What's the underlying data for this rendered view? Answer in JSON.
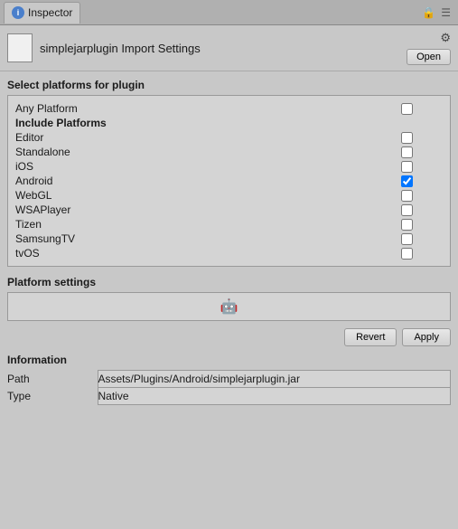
{
  "tab": {
    "label": "Inspector",
    "icon": "i"
  },
  "header": {
    "title": "simplejarplugin Import Settings",
    "open_label": "Open",
    "gear_symbol": "⚙"
  },
  "platforms_section": {
    "title": "Select platforms for plugin",
    "include_title": "Include Platforms",
    "platforms": [
      {
        "name": "Any Platform",
        "checked": false,
        "bold": false
      },
      {
        "name": "Editor",
        "checked": false,
        "bold": false
      },
      {
        "name": "Standalone",
        "checked": false,
        "bold": false
      },
      {
        "name": "iOS",
        "checked": false,
        "bold": false
      },
      {
        "name": "Android",
        "checked": true,
        "bold": false
      },
      {
        "name": "WebGL",
        "checked": false,
        "bold": false
      },
      {
        "name": "WSAPlayer",
        "checked": false,
        "bold": false
      },
      {
        "name": "Tizen",
        "checked": false,
        "bold": false
      },
      {
        "name": "SamsungTV",
        "checked": false,
        "bold": false
      },
      {
        "name": "tvOS",
        "checked": false,
        "bold": false
      }
    ]
  },
  "platform_settings": {
    "title": "Platform settings",
    "android_icon": "🤖"
  },
  "buttons": {
    "revert_label": "Revert",
    "apply_label": "Apply"
  },
  "information": {
    "title": "Information",
    "rows": [
      {
        "label": "Path",
        "value": "Assets/Plugins/Android/simplejarplugin.jar"
      },
      {
        "label": "Type",
        "value": "Native"
      }
    ]
  }
}
